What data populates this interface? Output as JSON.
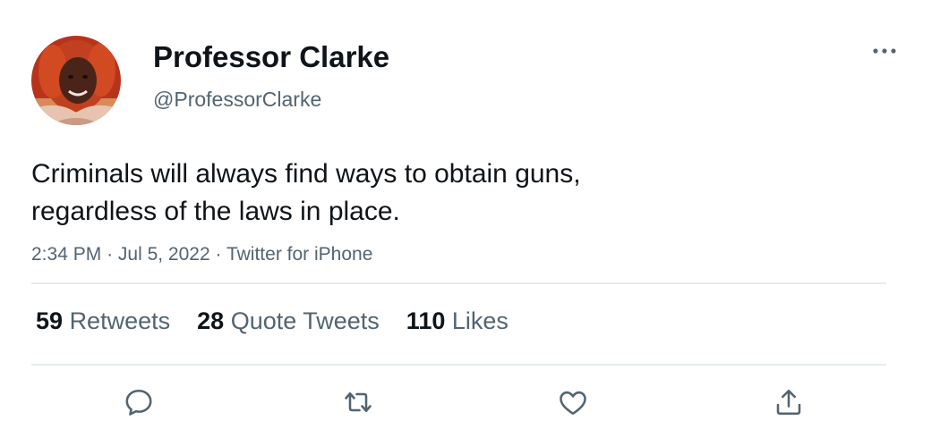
{
  "author": {
    "display_name": "Professor Clarke",
    "handle": "@ProfessorClarke"
  },
  "tweet": {
    "text_lines": [
      "Criminals will always find ways to obtain guns,",
      "regardless of the laws in place."
    ],
    "time": "2:34 PM",
    "date": "Jul 5, 2022",
    "source": "Twitter for iPhone",
    "separator": "·"
  },
  "stats": {
    "retweets": {
      "count": "59",
      "label": "Retweets"
    },
    "quote_tweets": {
      "count": "28",
      "label": "Quote Tweets"
    },
    "likes": {
      "count": "110",
      "label": "Likes"
    }
  },
  "actions": {
    "reply": {
      "icon": "reply-icon"
    },
    "retweet": {
      "icon": "retweet-icon"
    },
    "like": {
      "icon": "heart-icon"
    },
    "share": {
      "icon": "share-icon"
    }
  },
  "colors": {
    "primary_text": "#0f1419",
    "secondary_text": "#536471",
    "divider": "#e6ecf0"
  }
}
